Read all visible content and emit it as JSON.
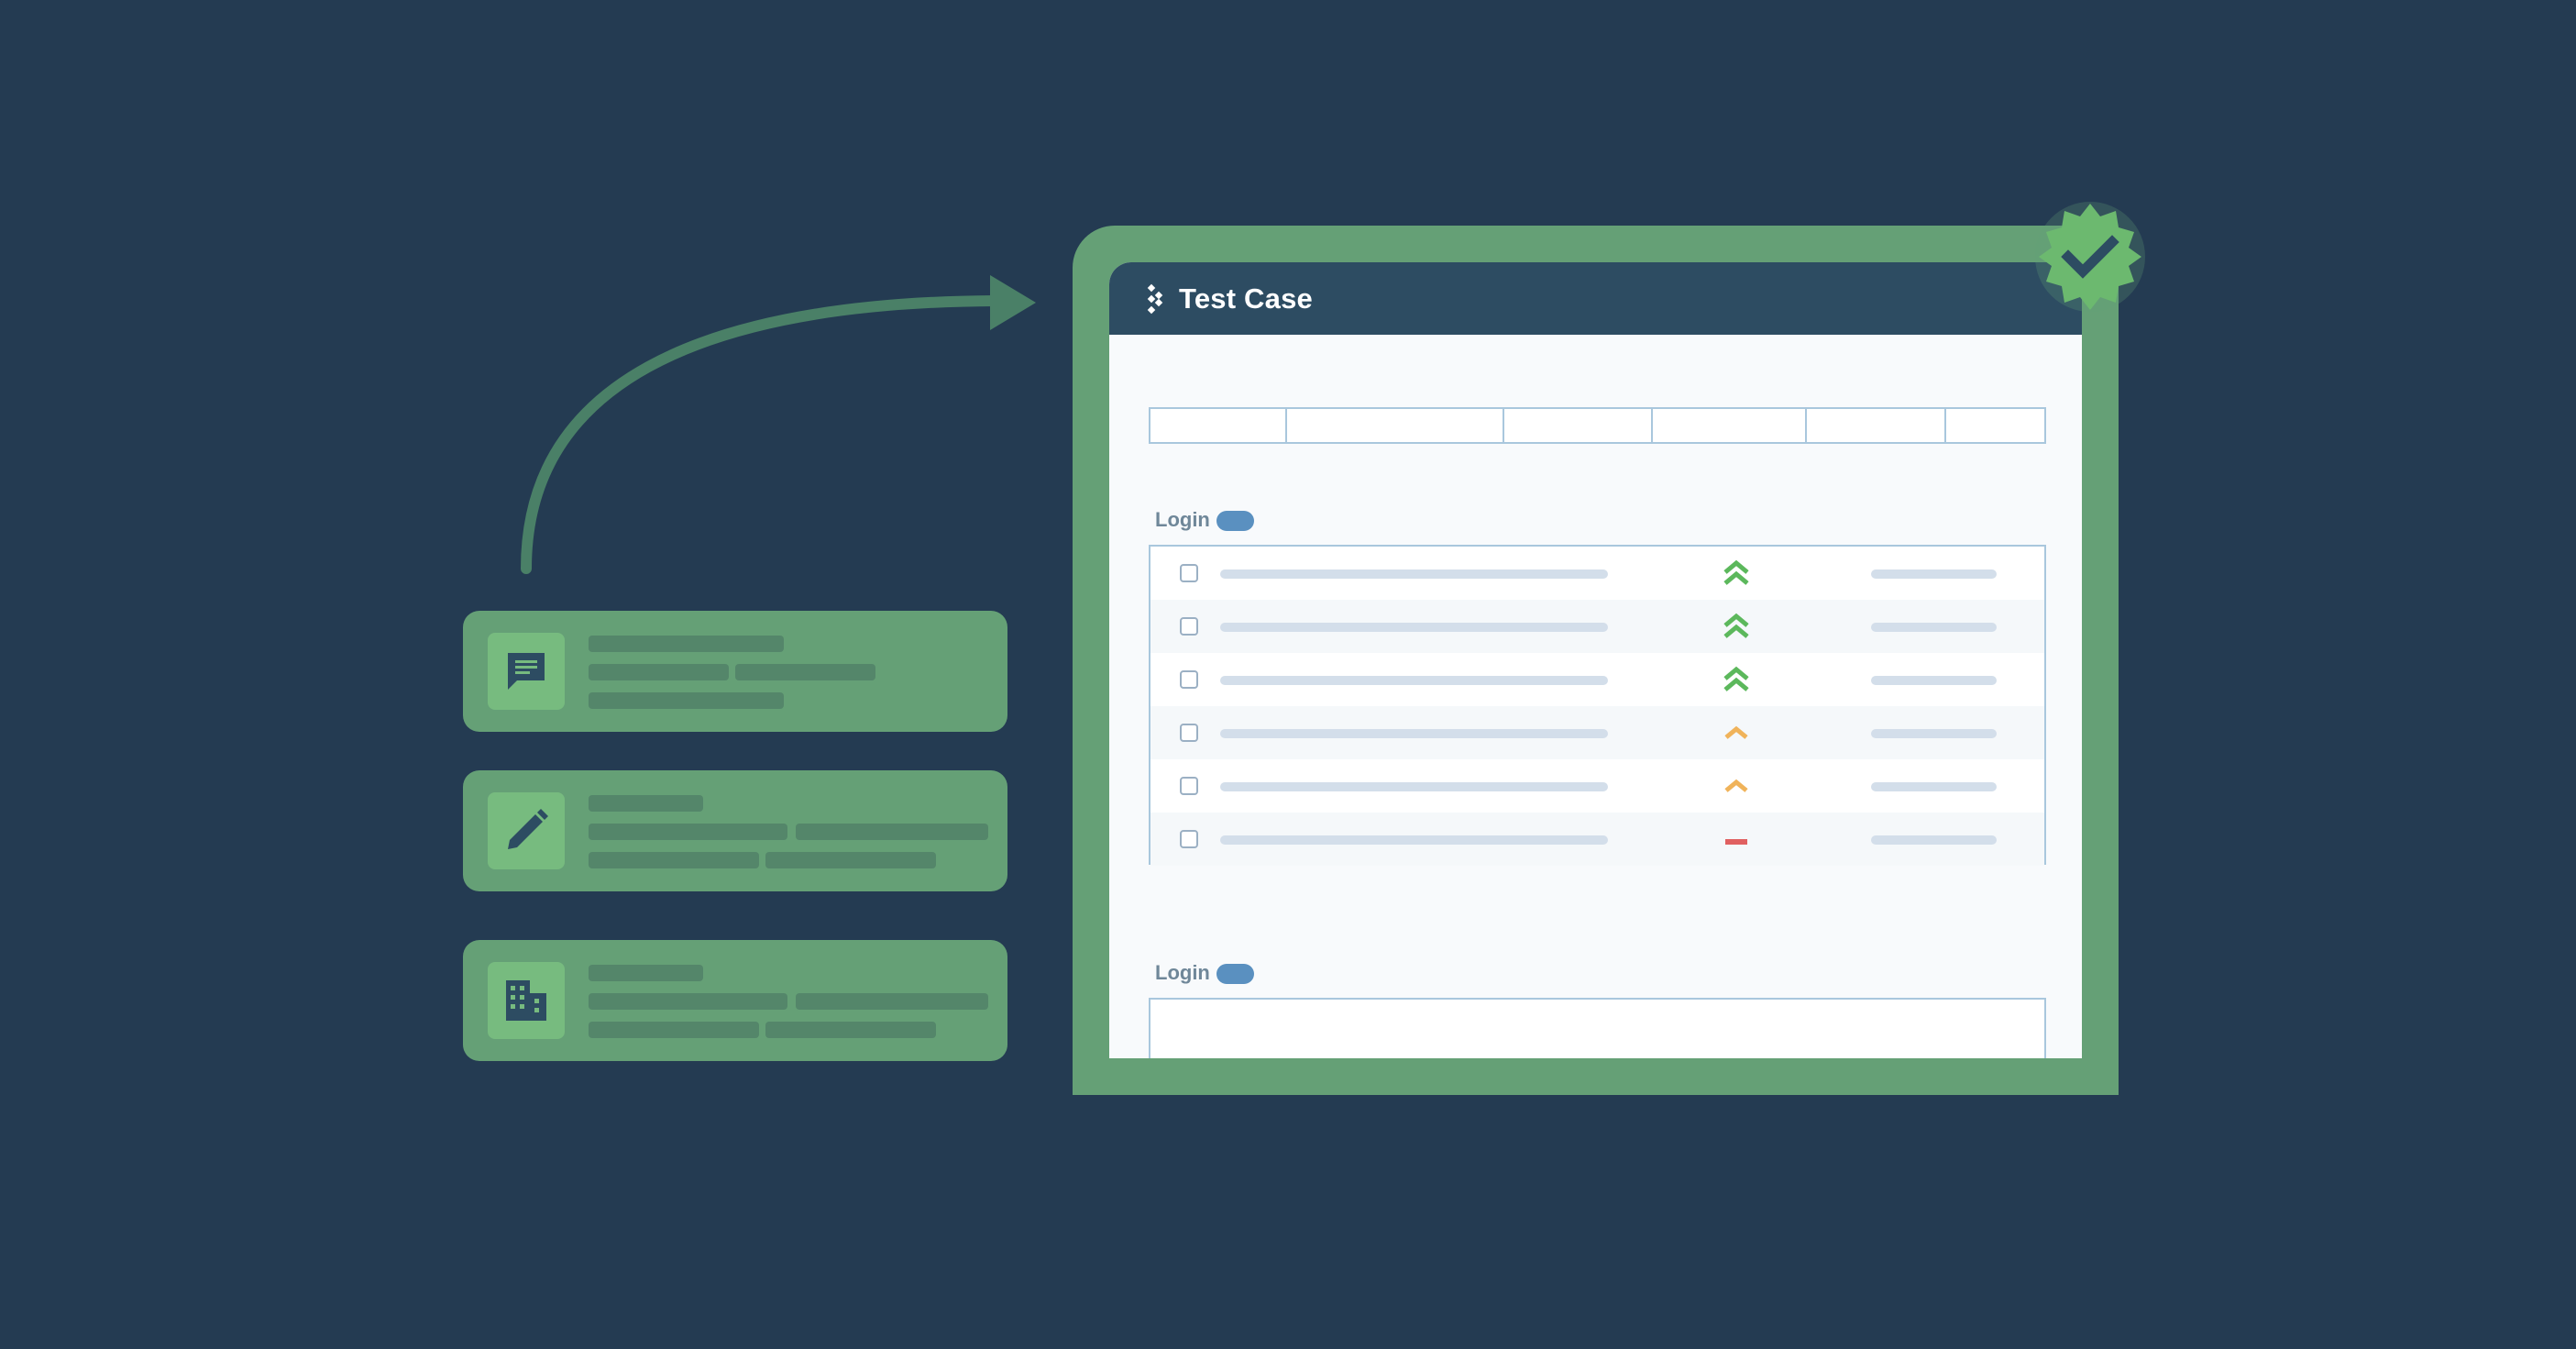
{
  "panel": {
    "title": "Test Case",
    "sections": [
      {
        "label": "Login"
      },
      {
        "label": "Login"
      }
    ]
  },
  "rows": [
    {
      "priority": "high"
    },
    {
      "priority": "high"
    },
    {
      "priority": "high"
    },
    {
      "priority": "medium"
    },
    {
      "priority": "medium"
    },
    {
      "priority": "low"
    }
  ],
  "colors": {
    "background": "#243b52",
    "frame": "#65a076",
    "header": "#2d4c62",
    "priority_high": "#5cb85c",
    "priority_medium": "#f0b35a",
    "priority_low": "#e06060",
    "pill": "#5a90c0"
  },
  "icons": [
    "chat-icon",
    "pencil-icon",
    "building-icon",
    "verified-check-icon",
    "arrow-icon"
  ]
}
